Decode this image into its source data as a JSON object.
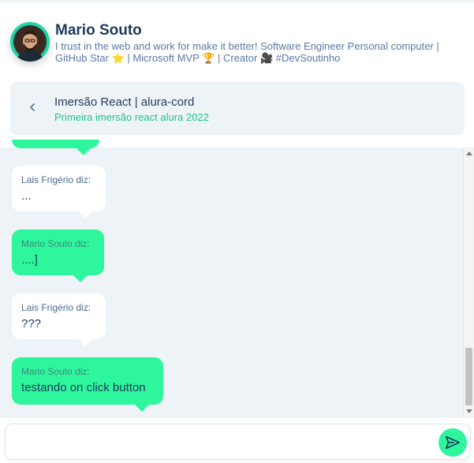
{
  "profile": {
    "name": "Mario Souto",
    "bio": "I trust in the web and work for make it better! Software Engineer Personal computer | GitHub Star ⭐ | Microsoft MVP 🏆 | Creator 🎥 #DevSoutinho"
  },
  "room": {
    "title": "Imersão React | alura-cord",
    "subtitle": "Primeira imersão react alura 2022"
  },
  "messages": [
    {
      "author": "Lais Frigério diz:",
      "text": "...",
      "style": "white"
    },
    {
      "author": "Mario Souto diz:",
      "text": "....]",
      "style": "green"
    },
    {
      "author": "Lais Frigério diz:",
      "text": "???",
      "style": "white"
    },
    {
      "author": "Mario Souto diz:",
      "text": "testando on click button",
      "style": "green"
    }
  ],
  "composer": {
    "value": "",
    "placeholder": ""
  },
  "colors": {
    "accent": "#2ef69c",
    "chat_background": "#eef3f8",
    "title": "#1f3a5c",
    "subtitle": "#1fc48a"
  },
  "icons": {
    "back": "chevron-left-icon",
    "send": "send-icon"
  }
}
